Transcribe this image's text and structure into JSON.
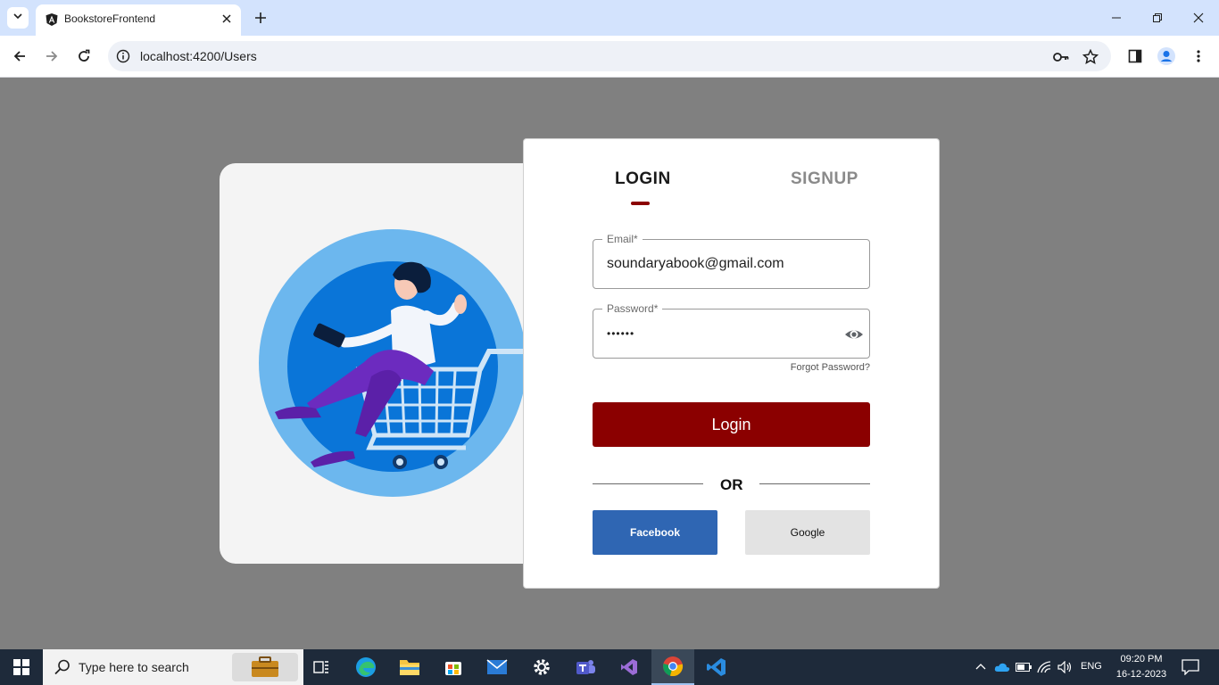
{
  "browser": {
    "tab_title": "BookstoreFrontend",
    "url": "localhost:4200/Users",
    "icons": {
      "tab_search": "chevron-down-icon",
      "favicon": "angular-icon",
      "close_tab": "close-icon",
      "new_tab": "plus-icon",
      "back": "arrow-left-icon",
      "forward": "arrow-right-icon",
      "reload": "reload-icon",
      "site_info": "info-icon",
      "passwords": "key-icon",
      "bookmark": "star-icon",
      "side_panel": "side-panel-icon",
      "profile": "profile-icon",
      "menu": "kebab-menu-icon"
    }
  },
  "auth": {
    "tabs": {
      "login": "LOGIN",
      "signup": "SIGNUP"
    },
    "email": {
      "label": "Email*",
      "value": "soundaryabook@gmail.com"
    },
    "password": {
      "label": "Password*",
      "value": "••••••"
    },
    "forgot_password": "Forgot Password?",
    "login_button": "Login",
    "divider_text": "OR",
    "facebook_button": "Facebook",
    "google_button": "Google",
    "colors": {
      "primary": "#8b0000",
      "facebook": "#2f66b3",
      "google": "#e3e3e3"
    }
  },
  "taskbar": {
    "search_placeholder": "Type here to search",
    "apps": [
      "task-view-icon",
      "edge-icon",
      "file-explorer-icon",
      "store-icon",
      "mail-icon",
      "settings-icon",
      "teams-icon",
      "visual-studio-icon",
      "chrome-icon",
      "vscode-icon"
    ],
    "tray": {
      "language": "ENG",
      "time": "09:20 PM",
      "date": "16-12-2023"
    }
  }
}
